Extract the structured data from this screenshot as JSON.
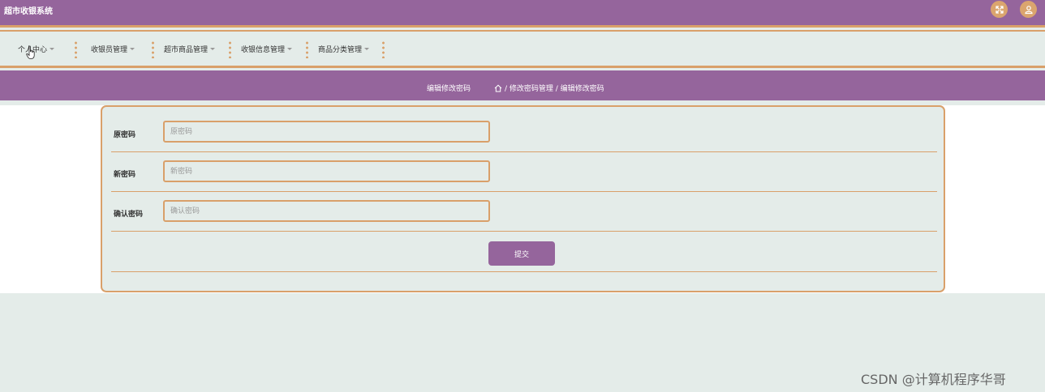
{
  "app": {
    "title": "超市收银系统"
  },
  "header_icons": [
    "fullscreen-icon",
    "user-icon"
  ],
  "nav": {
    "items": [
      {
        "label": "个人中心"
      },
      {
        "label": "收银员管理"
      },
      {
        "label": "超市商品管理"
      },
      {
        "label": "收银信息管理"
      },
      {
        "label": "商品分类管理"
      }
    ]
  },
  "banner": {
    "title": "编辑修改密码",
    "breadcrumb": "/ 修改密码管理 / 编辑修改密码"
  },
  "form": {
    "fields": [
      {
        "label": "原密码",
        "placeholder": "原密码"
      },
      {
        "label": "新密码",
        "placeholder": "新密码"
      },
      {
        "label": "确认密码",
        "placeholder": "确认密码"
      }
    ],
    "submit_label": "提交"
  },
  "watermark": "CSDN @计算机程序华哥",
  "colors": {
    "primary": "#95659c",
    "accent": "#d9a06a",
    "background": "#e4ece9"
  }
}
